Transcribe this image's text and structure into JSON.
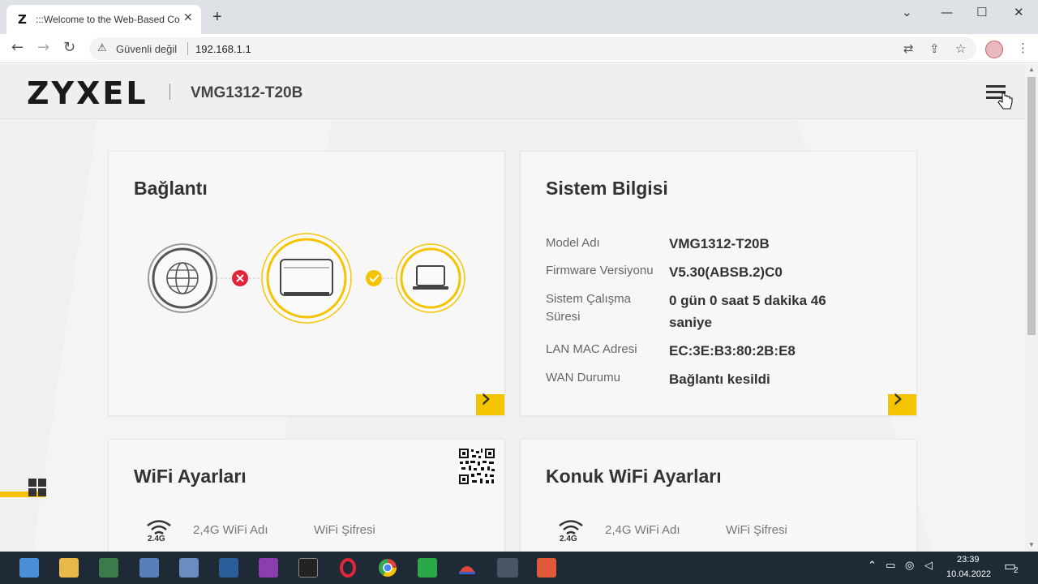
{
  "browser": {
    "tab_favicon": "Z",
    "tab_title": ":::Welcome to the Web-Based Co",
    "tab_close": "✕",
    "new_tab": "+",
    "security_label": "Güvenli değil",
    "url": "192.168.1.1",
    "icons": {
      "back": "back-arrow-icon",
      "forward": "forward-arrow-icon",
      "reload": "reload-icon",
      "warning": "warning-icon",
      "translate": "translate-icon",
      "share": "share-icon",
      "bookmark": "star-icon",
      "menu": "kebab-menu-icon"
    }
  },
  "header": {
    "logo": "ZYXEL",
    "model": "VMG1312-T20B"
  },
  "cards": {
    "connection": {
      "title": "Bağlantı"
    },
    "system": {
      "title": "Sistem Bilgisi",
      "rows": [
        {
          "label": "Model Adı",
          "value": "VMG1312-T20B"
        },
        {
          "label": "Firmware Versiyonu",
          "value": "V5.30(ABSB.2)C0"
        },
        {
          "label": "Sistem Çalışma Süresi",
          "value": "0 gün 0 saat 5 dakika 46 saniye"
        },
        {
          "label": "LAN MAC Adresi",
          "value": "EC:3E:B3:80:2B:E8"
        },
        {
          "label": "WAN Durumu",
          "value": "Bağlantı kesildi"
        }
      ]
    },
    "wifi": {
      "title": "WiFi Ayarları",
      "band": "2.4G",
      "name_label": "2,4G WiFi Adı",
      "pass_label": "WiFi Şifresi"
    },
    "guest": {
      "title": "Konuk WiFi Ayarları",
      "band": "2.4G",
      "name_label": "2,4G WiFi Adı",
      "pass_label": "WiFi Şifresi"
    }
  },
  "taskbar": {
    "time": "23:39",
    "date": "10.04.2022",
    "notifications": "2"
  },
  "colors": {
    "accent": "#f5c400",
    "error": "#e0263a",
    "ok": "#f5c400"
  }
}
